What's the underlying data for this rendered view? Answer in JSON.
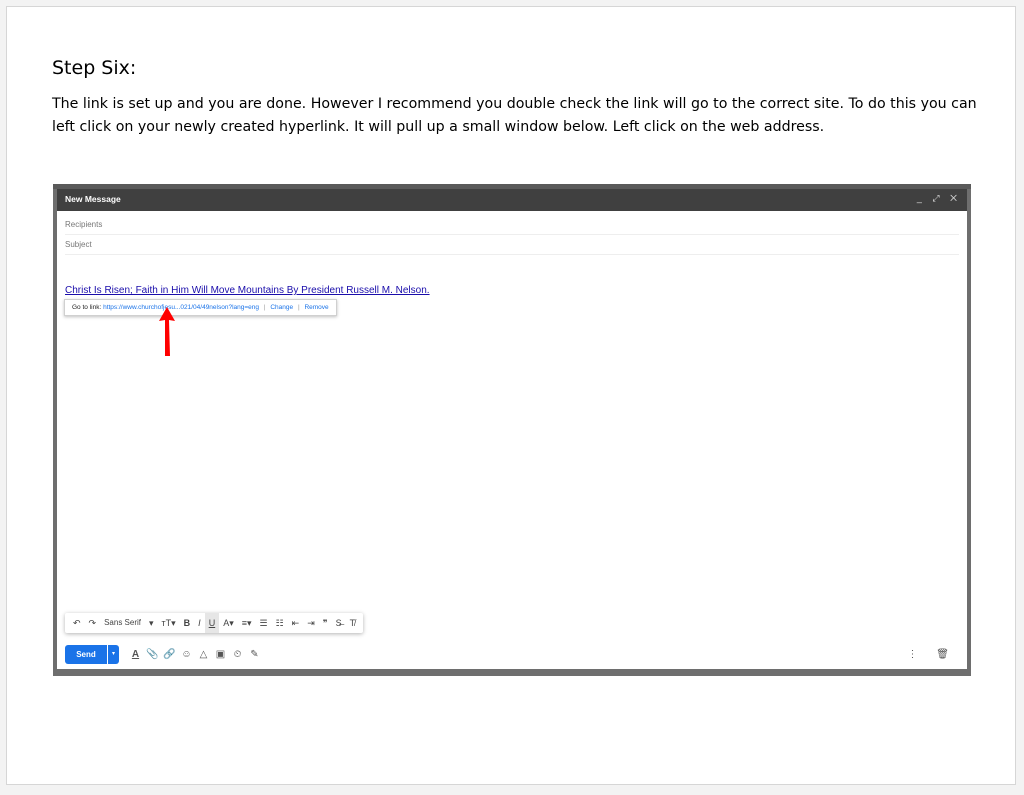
{
  "heading": "Step Six:",
  "instructions": "The link is set up and you are done. However I recommend you double check the link will go to the correct site. To do this you can left click on your newly created hyperlink. It will pull up a small window below. Left click on the web address.",
  "compose": {
    "title": "New Message",
    "window_controls": "_ ⤢ ✕",
    "recipients_placeholder": "Recipients",
    "subject_placeholder": "Subject",
    "link_text": "Christ Is Risen; Faith in Him Will Move Mountains By President Russell M. Nelson.",
    "popup": {
      "go_to_label": "Go to link:",
      "url": "https://www.churchofjesu...021/04/49nelson?lang=eng",
      "separator": "|",
      "change": "Change",
      "remove": "Remove"
    },
    "toolbar": {
      "undo": "↶",
      "redo": "↷",
      "font": "Sans Serif",
      "font_caret": "▾",
      "size": "ᴛT▾",
      "bold": "B",
      "italic": "I",
      "underline": "U",
      "text_color": "A▾",
      "align": "≡▾",
      "numbered_list": "☰",
      "bulleted_list": "☷",
      "indent_less": "⇤",
      "indent_more": "⇥",
      "quote": "❞",
      "strikethrough": "S̶",
      "clear_format": "T̸"
    },
    "send_label": "Send",
    "send_options": "▾",
    "bottom_icons": {
      "formatting": "A",
      "attach": "📎",
      "link": "🔗",
      "emoji": "☺",
      "drive": "△",
      "photo": "▣",
      "lock": "⏲",
      "signature": "✎"
    },
    "more_options": "⋮",
    "discard": "🗑"
  },
  "colors": {
    "link": "#1a0dab",
    "send": "#1a73e8",
    "header": "#404040",
    "arrow": "#ff0000"
  }
}
